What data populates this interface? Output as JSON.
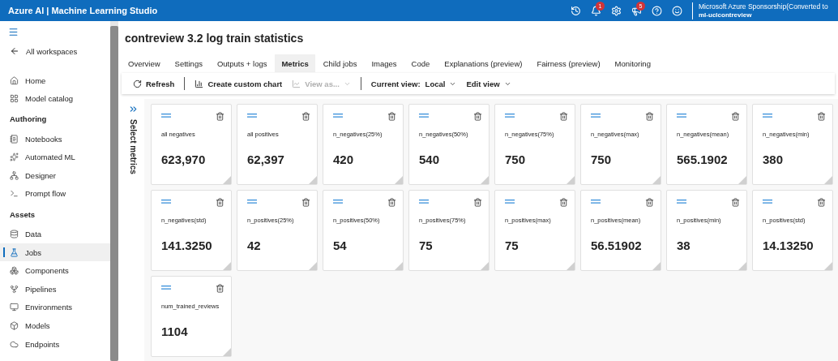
{
  "topbar": {
    "title": "Azure AI | Machine Learning Studio",
    "badges": [
      {
        "kind": "history"
      },
      {
        "kind": "bell",
        "count": "1"
      },
      {
        "kind": "settings"
      },
      {
        "kind": "megaphone",
        "count": "5"
      },
      {
        "kind": "help"
      },
      {
        "kind": "feedback"
      }
    ],
    "account": {
      "subscription": "Microsoft Azure Sponsorship(Converted to",
      "workspace": "ml-uclcontreview"
    }
  },
  "sidebar": {
    "back": "All workspaces",
    "items": [
      {
        "kind": "item",
        "label": "Home",
        "selected": false
      },
      {
        "kind": "item",
        "label": "Model catalog",
        "selected": false
      },
      {
        "kind": "heading",
        "label": "Authoring"
      },
      {
        "kind": "item",
        "label": "Notebooks",
        "selected": false
      },
      {
        "kind": "item",
        "label": "Automated ML",
        "selected": false
      },
      {
        "kind": "item",
        "label": "Designer",
        "selected": false
      },
      {
        "kind": "item",
        "label": "Prompt flow",
        "selected": false
      },
      {
        "kind": "heading",
        "label": "Assets"
      },
      {
        "kind": "item",
        "label": "Data",
        "selected": false
      },
      {
        "kind": "item",
        "label": "Jobs",
        "selected": true
      },
      {
        "kind": "item",
        "label": "Components",
        "selected": false
      },
      {
        "kind": "item",
        "label": "Pipelines",
        "selected": false
      },
      {
        "kind": "item",
        "label": "Environments",
        "selected": false
      },
      {
        "kind": "item",
        "label": "Models",
        "selected": false
      },
      {
        "kind": "item",
        "label": "Endpoints",
        "selected": false
      }
    ]
  },
  "page": {
    "title": "contreview 3.2 log train statistics",
    "tabs": [
      {
        "label": "Overview",
        "selected": false
      },
      {
        "label": "Settings",
        "selected": false
      },
      {
        "label": "Outputs + logs",
        "selected": false
      },
      {
        "label": "Metrics",
        "selected": true
      },
      {
        "label": "Child jobs",
        "selected": false
      },
      {
        "label": "Images",
        "selected": false
      },
      {
        "label": "Code",
        "selected": false
      },
      {
        "label": "Explanations (preview)",
        "selected": false
      },
      {
        "label": "Fairness (preview)",
        "selected": false
      },
      {
        "label": "Monitoring",
        "selected": false
      }
    ],
    "toolbar": {
      "refresh": "Refresh",
      "create_chart": "Create custom chart",
      "view_as": {
        "label": "View as...",
        "disabled": true
      },
      "current_view_label": "Current view:",
      "current_view": "Local",
      "edit_view": "Edit view"
    },
    "select_metrics": "Select metrics",
    "cards": [
      {
        "name": "all negatives",
        "value": "623,970"
      },
      {
        "name": "all positives",
        "value": "62,397"
      },
      {
        "name": "n_negatives(25%)",
        "value": "420"
      },
      {
        "name": "n_negatives(50%)",
        "value": "540"
      },
      {
        "name": "n_negatives(75%)",
        "value": "750"
      },
      {
        "name": "n_negatives(max)",
        "value": "750"
      },
      {
        "name": "n_negatives(mean)",
        "value": "565.1902"
      },
      {
        "name": "n_negatives(min)",
        "value": "380"
      },
      {
        "name": "n_negatives(std)",
        "value": "141.3250"
      },
      {
        "name": "n_positives(25%)",
        "value": "42"
      },
      {
        "name": "n_positives(50%)",
        "value": "54"
      },
      {
        "name": "n_positives(75%)",
        "value": "75"
      },
      {
        "name": "n_positives(max)",
        "value": "75"
      },
      {
        "name": "n_positives(mean)",
        "value": "56.51902"
      },
      {
        "name": "n_positives(min)",
        "value": "38"
      },
      {
        "name": "n_positives(std)",
        "value": "14.13250"
      },
      {
        "name": "num_trained_reviews",
        "value": "1104"
      }
    ]
  }
}
